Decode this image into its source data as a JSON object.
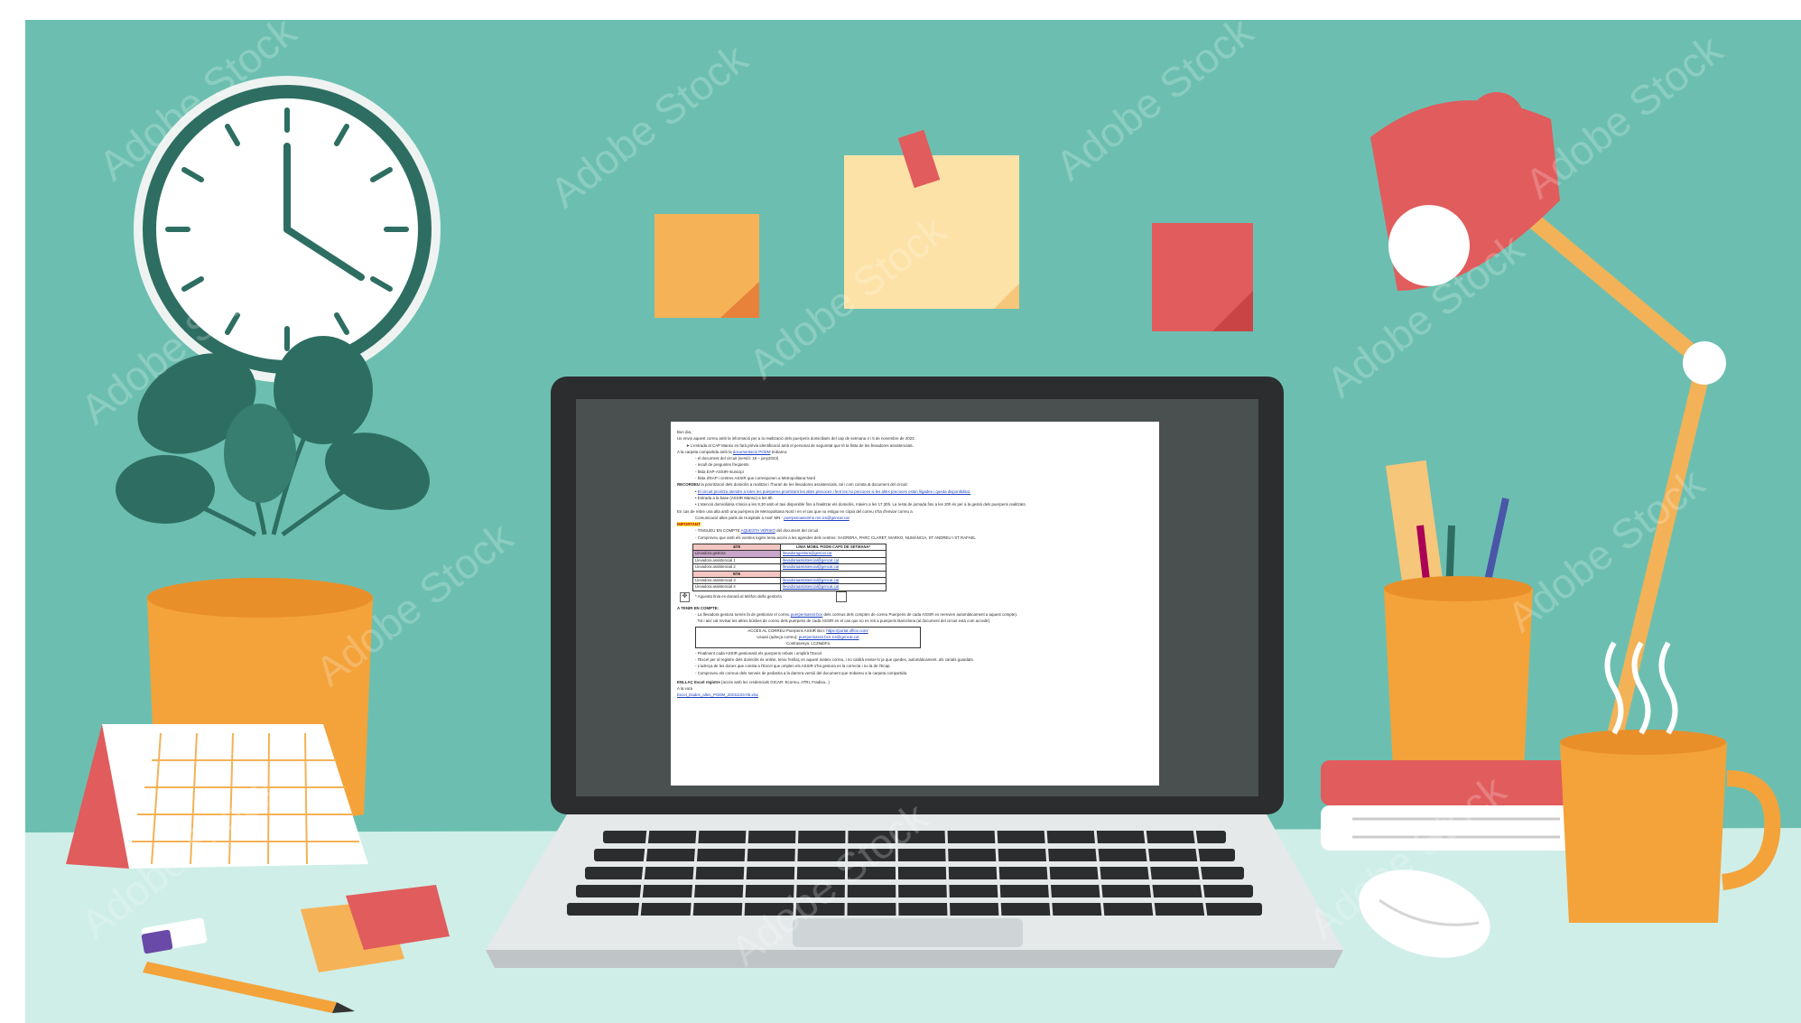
{
  "colors": {
    "wall": "#6cbfb0",
    "desk": "#cfeee8",
    "laptop_frame": "#2c2d2f",
    "screen_bezel": "#4a4f50",
    "lamp_red": "#e15c5c",
    "lamp_arm": "#f3b257",
    "note_yellow": "#fde2a7",
    "note_orange": "#f5b04f",
    "pot_orange": "#f3a33a",
    "plant_green": "#2e6e62",
    "clock_face": "#ffffff"
  },
  "watermark": {
    "text": "Adobe Stock"
  },
  "document": {
    "greeting": "Bon dia,",
    "intro": "Us envio aquest correu amb la informació per a la realització dels puerperis domiciliaris del cap de setmana 4 i 5 de novembre de 2023.",
    "arrow_item": "L'entrada al CAP Manso es farà prèvia identificació amb el personal de seguretat que té la llista de les llevadores assistencials.",
    "folder_prefix": "A la carpeta compartida amb la ",
    "folder_link": "documentació PODM",
    "folder_suffix": " trobareu:",
    "folder_items": [
      "el document del circuit (versió: 18 – juny2023)",
      "recull de preguntes freqüents",
      "llista EAP-ASSIR-municipi",
      "llista d'EAP i centres ASSIR que corresponen a Metropolitana Nord"
    ],
    "recordeu_bold": "RECORDEU",
    "recordeu_text": " la priorització dels domicilis a realitzar i l'horari de les llevadores assistencials, tal i com consta al document del circuit:",
    "recordeu_items": [
      "El circuit prioritza atendre a totes les puèrperes prioritzant les altes precoces i fent les no precoces si les altes precoces estan lligades i queda disponibilitat.",
      "Entrada a la base (ASSIR Manso) a les 8h.",
      "L'atenció domiciliària s'inicia a les 9,30 amb el taxi disponible fins a finalitzar els domicilis, màxim a les 17,30h. La resta de jornada fins a les 20h és per a la gestió dels puerperis realitzats."
    ],
    "metro_text": "En cas de rebre una alta amb una puèrpera de Metropolitana Nord i en el cas que no estigui en còpia del correu s'ha d'enviar correu a",
    "metro_line2": "Comunicació altes parts de Hospitals a Asst' MN -",
    "metro_email": "puerperioassirmn.mn.ics@gencat.cat",
    "important_label": "IMPORTANT",
    "important_items": [
      {
        "pre": "TINGUEU EN COMPTE ",
        "link": "AQUESTA VERSIÓ",
        "post": " del document del circuit"
      },
      {
        "pre": "Comproveu que amb els vostres logins teniu accés a les agendes dels centres: SAGRERA, PARC CLARET, MARKO, NUMÀNCIA, ST ANDREU I ST RAFAEL",
        "link": "",
        "post": ""
      }
    ],
    "table": {
      "header_left_1": "4/05",
      "header_right": "LÍNIA MOBIL PODM CAPS DE SETMANA*",
      "rows_1": [
        {
          "role": "Llevadora gestora",
          "email": "llevadoragestora@gencat.cat"
        },
        {
          "role": "Llevadora assistencial 1",
          "email": "llevadoraassistencial@gencat.cat"
        },
        {
          "role": "Llevadora assistencial 2",
          "email": "llevadoraassistencial@gencat.cat"
        }
      ],
      "header_left_2": "5/06",
      "rows_2": [
        {
          "role": "Llevadora assistencial 3",
          "email": "llevadoraassistencial@gencat.cat"
        },
        {
          "role": "Llevadora assistencial 4",
          "email": "llevadoraassistencial@gencat.cat"
        }
      ],
      "footnote": "* Aquesta línia es donarà al telèfon de/la gestor/a"
    },
    "tenir_label": "A TENIR EN COMPTE:",
    "tenir_items": [
      {
        "pre": "La llevadora gestora tornés fa de gestionar el correu ",
        "link": "puerperisassir.bcn",
        "post": " dels correus dels comptes de correu Puerperis de cada ASSIR es reenvien automàticament a aquest compte)."
      },
      {
        "pre": "Tot i així cal revisar les altres bústies de correu dels puerperis de cada ASSIR en el cas que no es reti a puerperis Barcelona (al document del circuit està com accedir).",
        "link": "",
        "post": ""
      }
    ],
    "access_box": {
      "line1_pre": "ACCÉS AL CORREU Puerperis ASSIR Bcn: ",
      "line1_link": "https://portal.office.com/",
      "line2_pre": "Usuari (adreça correu): ",
      "line2_link": "puerperisassir.bcn.ics@gencat.cat",
      "line3": "Contrasenya: LC29abFa"
    },
    "after_items": [
      "Finalment cada ASSIR gestionarà els puerperis rebuts i omplirà l'Excel.",
      "l'Excel per al registre dels domicilis és online, teniu l'enllaç en aquest mateix correu, i no caldrà enviar-lo ja que quedes, automàticament, als canals guardats.",
      "L'adreça de les dones que consta a l'Excel que omplen els ASSIR s'ha gestora es la correcta i no la de l'Ecap.",
      "Comproveu els correus dels serveis de pediatria a la darrera versió del document que trobareu a la carpeta compartida."
    ],
    "enllac_bold": "ENLLAÇ Excel registre",
    "enllac_text": " (accés amb les credencials GICAR: Ecorreu, ATRI, Fradisa...)",
    "sign": "A la vora",
    "excel_link": "Excel_Dades_altes_PODM_20231104-05.xlsx"
  }
}
